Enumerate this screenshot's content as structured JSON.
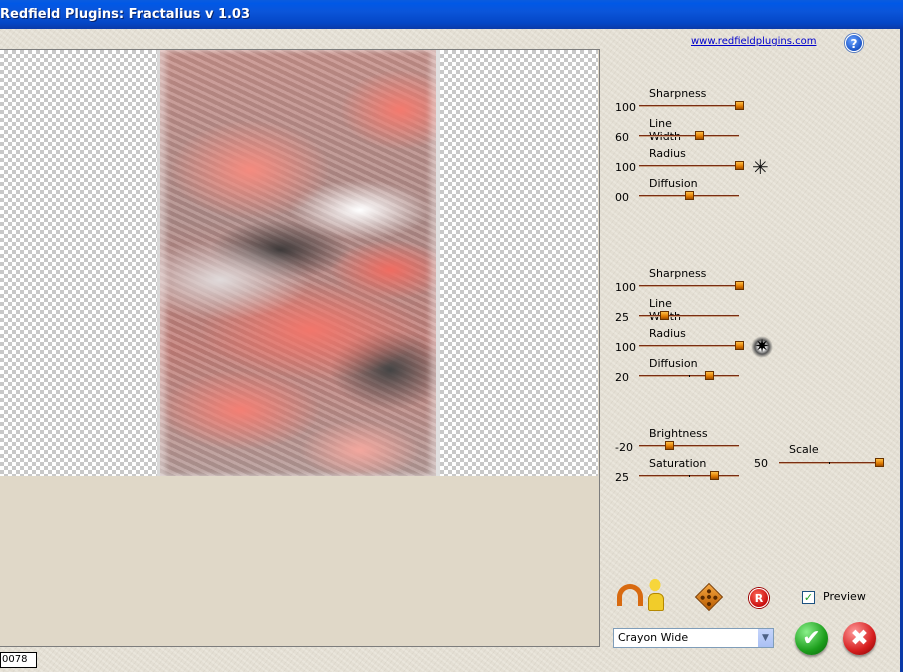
{
  "window": {
    "title": "Redfield Plugins: Fractalius v 1.03"
  },
  "header": {
    "link_text": "www.redfieldplugins.com",
    "help_icon": "question-icon",
    "help_glyph": "?"
  },
  "status": {
    "value": "0078"
  },
  "group1": {
    "sliders": [
      {
        "label": "Sharpness",
        "value": "100",
        "level": 1.0
      },
      {
        "label": "Line Width",
        "value": "60",
        "level": 0.6
      },
      {
        "label": "Radius",
        "value": "100",
        "level": 1.0
      },
      {
        "label": "Diffusion",
        "value": "00",
        "level": 0.5
      }
    ],
    "icon": "asterisk-icon",
    "glyph": "✳"
  },
  "group2": {
    "sliders": [
      {
        "label": "Sharpness",
        "value": "100",
        "level": 1.0
      },
      {
        "label": "Line Width",
        "value": "25",
        "level": 0.25
      },
      {
        "label": "Radius",
        "value": "100",
        "level": 1.0
      },
      {
        "label": "Diffusion",
        "value": "20",
        "level": 0.7
      }
    ],
    "icon": "glow-star-icon",
    "glyph": "✷"
  },
  "group3": {
    "sliders": [
      {
        "label": "Brightness",
        "value": "-20",
        "level": 0.3
      },
      {
        "label": "Saturation",
        "value": "25",
        "level": 0.75
      }
    ],
    "scale": {
      "label": "Scale",
      "value": "50",
      "level": 1.0
    }
  },
  "toolbar": {
    "icons": [
      "undo-arrow-icon",
      "person-icon",
      "dice-icon",
      "registered-icon"
    ],
    "reg_glyph": "R"
  },
  "preview": {
    "label": "Preview",
    "checked": true,
    "check_glyph": "✓"
  },
  "preset": {
    "selected": "Crayon Wide",
    "arrow_glyph": "▼"
  },
  "actions": {
    "ok_glyph": "✔",
    "cancel_glyph": "✖"
  }
}
